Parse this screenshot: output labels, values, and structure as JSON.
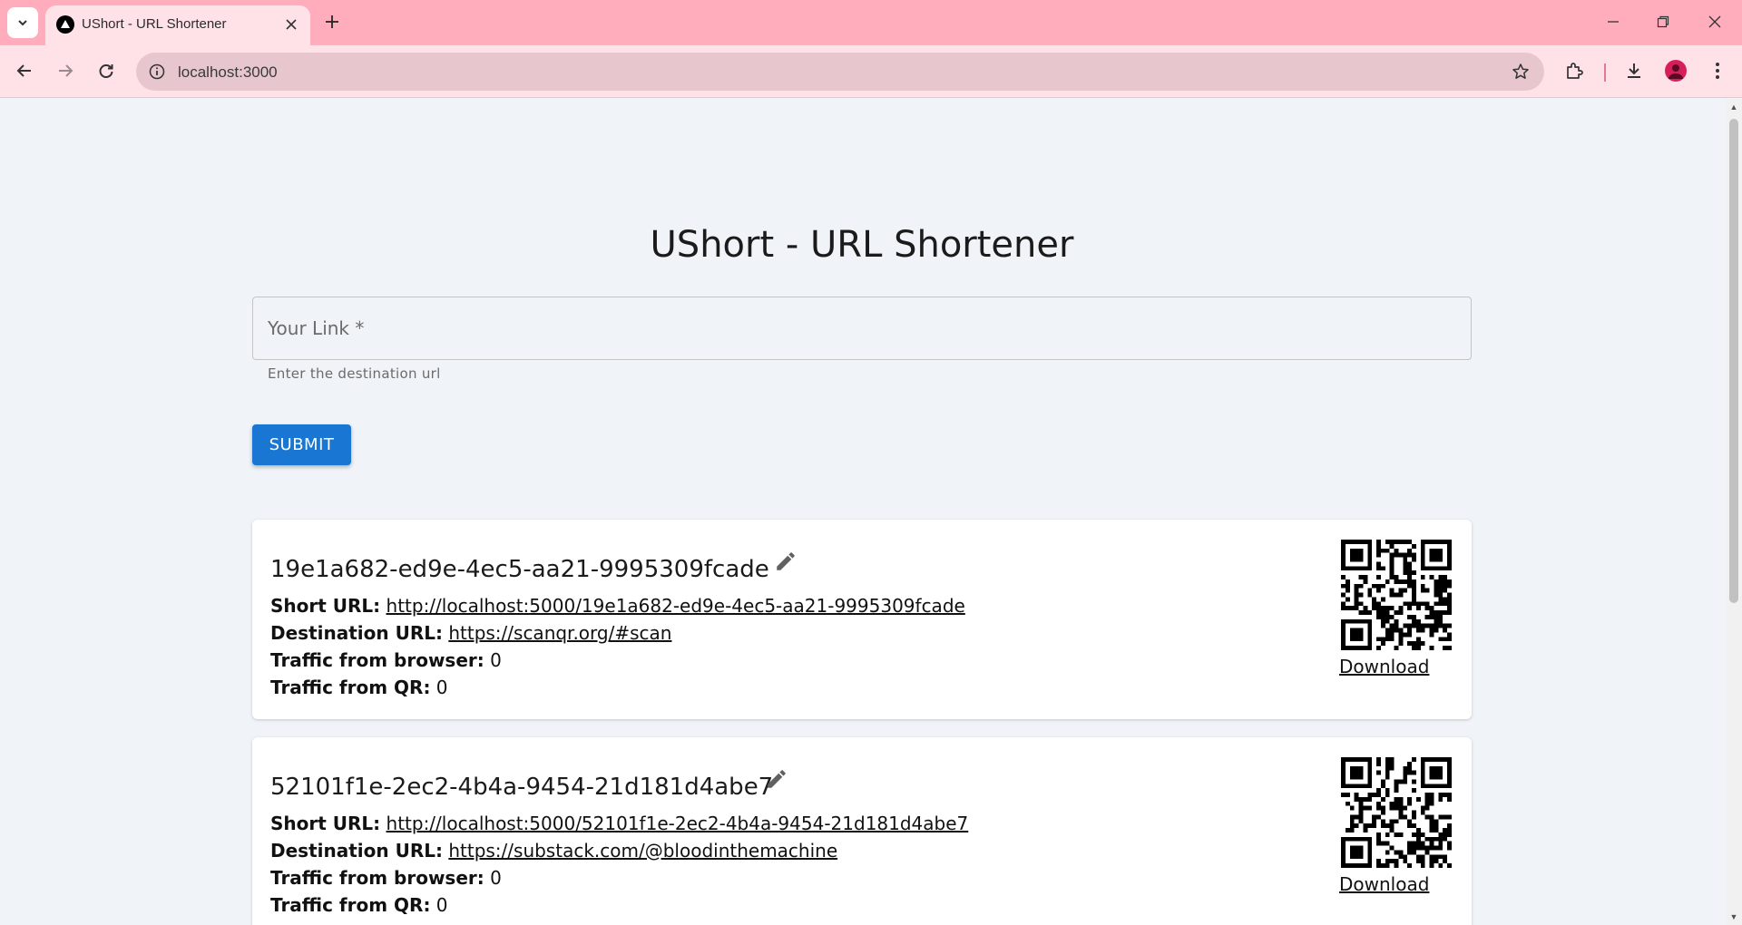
{
  "browser": {
    "tab_title": "UShort - URL Shortener",
    "address": "localhost:3000"
  },
  "page": {
    "title": "UShort - URL Shortener",
    "input": {
      "label": "Your Link *",
      "value": "",
      "helper": "Enter the destination url"
    },
    "submit_label": "SUBMIT",
    "labels": {
      "short_url": "Short URL:",
      "destination_url": "Destination URL:",
      "traffic_browser": "Traffic from browser:",
      "traffic_qr": "Traffic from QR:",
      "download": "Download"
    },
    "links": [
      {
        "id": "19e1a682-ed9e-4ec5-aa21-9995309fcade",
        "short_url": "http://localhost:5000/19e1a682-ed9e-4ec5-aa21-9995309fcade",
        "destination_url": "https://scanqr.org/#scan",
        "traffic_browser": "0",
        "traffic_qr": "0"
      },
      {
        "id": "52101f1e-2ec2-4b4a-9454-21d181d4abe7",
        "short_url": "http://localhost:5000/52101f1e-2ec2-4b4a-9454-21d181d4abe7",
        "destination_url": "https://substack.com/@bloodinthemachine",
        "traffic_browser": "0",
        "traffic_qr": "0"
      }
    ]
  },
  "colors": {
    "tabbar": "#ffacbd",
    "toolbar": "#ffe2e8",
    "accent": "#1976d2",
    "page_bg": "#f0f3f7"
  }
}
